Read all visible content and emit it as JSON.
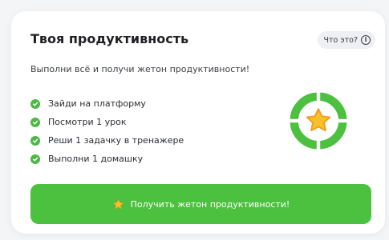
{
  "card": {
    "title": "Твоя продуктивность",
    "help_label": "Что это?",
    "subtitle": "Выполни всё и получи жетон продуктивности!",
    "tasks": [
      {
        "label": "Зайди на платформу",
        "done": true
      },
      {
        "label": "Посмотри 1 урок",
        "done": true
      },
      {
        "label": "Реши 1 задачку в тренажере",
        "done": true
      },
      {
        "label": "Выполни 1 домашку",
        "done": true
      }
    ],
    "badge": {
      "segments_total": 4,
      "segments_filled": 4,
      "icon": "star-icon"
    },
    "cta_label": "Получить жетон продуктивности!"
  },
  "colors": {
    "accent_green": "#4cc03f",
    "check_green": "#4cb944",
    "star_yellow": "#f6c22c",
    "star_orange": "#f29a1e",
    "pill_bg": "#eef0f3"
  }
}
